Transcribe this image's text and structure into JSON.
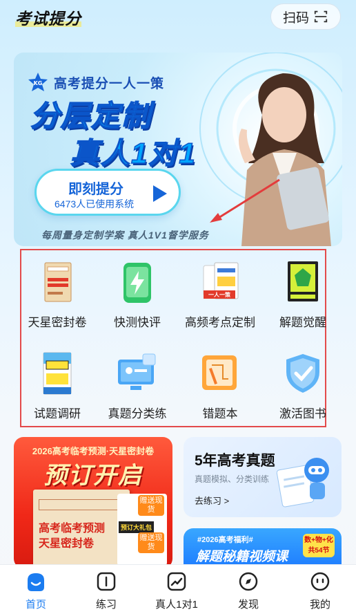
{
  "header": {
    "title": "考试提分",
    "scan_label": "扫码"
  },
  "banner": {
    "subtitle": "高考提分一人一策",
    "line1": "分层定制",
    "line2": "真人1对1",
    "cta_main": "即刻提分",
    "cta_sub": "6473人已使用系统",
    "footer": "每周量身定制学案  真人1V1督学服务"
  },
  "features": [
    {
      "label": "天星密封卷",
      "icon": "sealed-paper-book-icon"
    },
    {
      "label": "快测快评",
      "icon": "phone-lightning-icon"
    },
    {
      "label": "高频考点定制",
      "icon": "custom-book-icon"
    },
    {
      "label": "解题觉醒",
      "icon": "awakening-book-icon"
    },
    {
      "label": "试题调研",
      "icon": "research-book-icon"
    },
    {
      "label": "真题分类练",
      "icon": "monitor-icon"
    },
    {
      "label": "错题本",
      "icon": "notebook-icon"
    },
    {
      "label": "激活图书",
      "icon": "shield-check-icon"
    }
  ],
  "promo_left": {
    "top": "2026高考临考预测·天星密封卷",
    "big": "预订开启",
    "book_line1": "高考临考预测",
    "book_line2": "天星密封卷",
    "gift_tag": "赠送现货",
    "gift_label": "预订大礼包",
    "gift_tag2": "赠送现货"
  },
  "promo_right_top": {
    "title": "5年高考真题",
    "subtitle": "真题模拟、分类训练",
    "link": "去练习 >"
  },
  "promo_right_bottom": {
    "tag": "#2026高考福利#",
    "title": "解题秘籍视频课",
    "badge": "数+物+化 共54节"
  },
  "tabs": [
    {
      "label": "首页",
      "icon": "home-icon"
    },
    {
      "label": "练习",
      "icon": "practice-icon"
    },
    {
      "label": "真人1对1",
      "icon": "trend-icon"
    },
    {
      "label": "发现",
      "icon": "compass-icon"
    },
    {
      "label": "我的",
      "icon": "profile-icon"
    }
  ],
  "colors": {
    "accent": "#1b7cf0",
    "highlight_border": "#e34a4a",
    "promo_red": "#f02818"
  }
}
